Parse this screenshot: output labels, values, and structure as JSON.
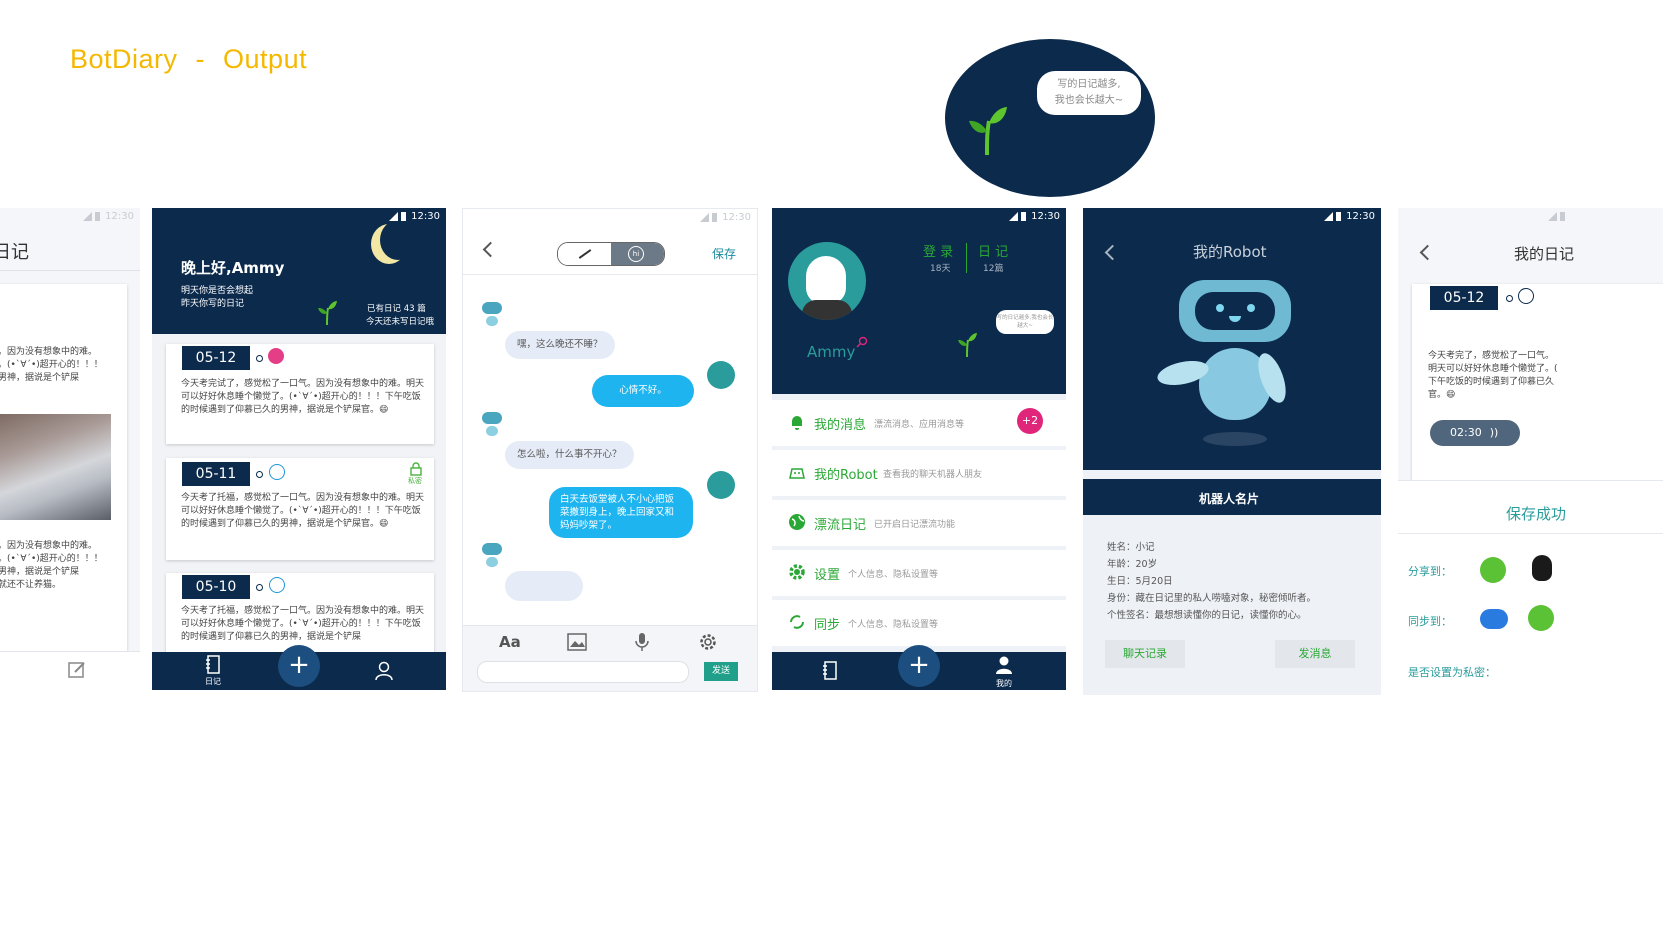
{
  "header": {
    "app": "BotDiary",
    "dash": "-",
    "section": "Output"
  },
  "time": "12:30",
  "promo_bubble": {
    "line1": "写的日记越多,",
    "line2": "我也会长越大~"
  },
  "screen1": {
    "title": "日记",
    "text1": "了。因为没有想象中的难。\n气。(•`∀´•)超开心的！！！\n的男神，据说是个铲屎",
    "text2": "了。因为没有想象中的难。\n气。(•`∀´•)超开心的！！！\n的男神，据说是个铲屎\n酱就还不让养猫。"
  },
  "screen2": {
    "greeting": "晚上好,Ammy",
    "sub1": "明天你是否会想起",
    "sub2": "昨天你写的日记",
    "stat1": "已有日记 43 篇",
    "stat2": "今天还未写日记哦",
    "private_label": "私密",
    "entries": [
      {
        "date": "05-12",
        "text": "今天考完试了，感觉松了一口气。因为没有想象中的难。明天可以好好休息睡个懒觉了。(•`∀´•)超开心的！！！下午吃饭的时候遇到了仰慕已久的男神，据说是个铲屎官。😄"
      },
      {
        "date": "05-11",
        "text": "今天考了托福，感觉松了一口气。因为没有想象中的难。明天可以好好休息睡个懒觉了。(•`∀´•)超开心的！！！下午吃饭的时候遇到了仰慕已久的男神，据说是个铲屎官。😄"
      },
      {
        "date": "05-10",
        "text": "今天考了托福，感觉松了一口气。因为没有想象中的难。明天可以好好休息睡个懒觉了。(•`∀´•)超开心的！！！下午吃饭的时候遇到了仰慕已久的男神，据说是个铲屎"
      }
    ],
    "tab_diary": "日记",
    "plus": "+"
  },
  "screen3": {
    "save": "保存",
    "hi": "hi",
    "msgs": [
      "嘿，这么晚还不睡？",
      "心情不好。",
      "怎么啦，什么事不开心？",
      "白天去饭堂被人不小心把饭菜撒到身上，晚上回家又和妈妈吵架了。"
    ],
    "toolbar_aa": "Aa",
    "send": "发送"
  },
  "screen4": {
    "login_label": "登 录",
    "login_days": "18天",
    "diary_label": "日 记",
    "diary_count": "12篇",
    "name": "Ammy",
    "tip": "写的日记越多,我也会长越大~",
    "badge": "+2",
    "menu": [
      {
        "label": "我的消息",
        "sub": "漂流消息、应用消息等"
      },
      {
        "label": "我的Robot",
        "sub": "查看我的聊天机器人朋友"
      },
      {
        "label": "漂流日记",
        "sub": "已开启日记漂流功能"
      },
      {
        "label": "设置",
        "sub": "个人信息、隐私设置等"
      },
      {
        "label": "同步",
        "sub": "个人信息、隐私设置等"
      }
    ],
    "tab_me": "我的"
  },
  "screen5": {
    "title": "我的Robot",
    "card_title": "机器人名片",
    "info": [
      "姓名：小记",
      "年龄：20岁",
      "生日：5月20日",
      "身份：藏在日记里的私人唠嗑对象，秘密倾听者。",
      "个性签名：最想想读懂你的日记，读懂你的心。"
    ],
    "btn_history": "聊天记录",
    "btn_send": "发消息"
  },
  "screen6": {
    "title": "我的日记",
    "date": "05-12",
    "text": "今天考完了，感觉松了一口气。\n明天可以好好休息睡个懒觉了。(\n下午吃饭的时候遇到了仰慕已久\n官。😄",
    "audio": "02:30",
    "saved": "保存成功",
    "share": "分享到：",
    "sync": "同步到：",
    "private": "是否设置为私密："
  },
  "colors": {
    "navy": "#0b2a4c",
    "accent_yellow": "#f5b800",
    "green": "#2aa836",
    "bubble_blue": "#1eb4ef",
    "badge_pink": "#e0267a"
  }
}
